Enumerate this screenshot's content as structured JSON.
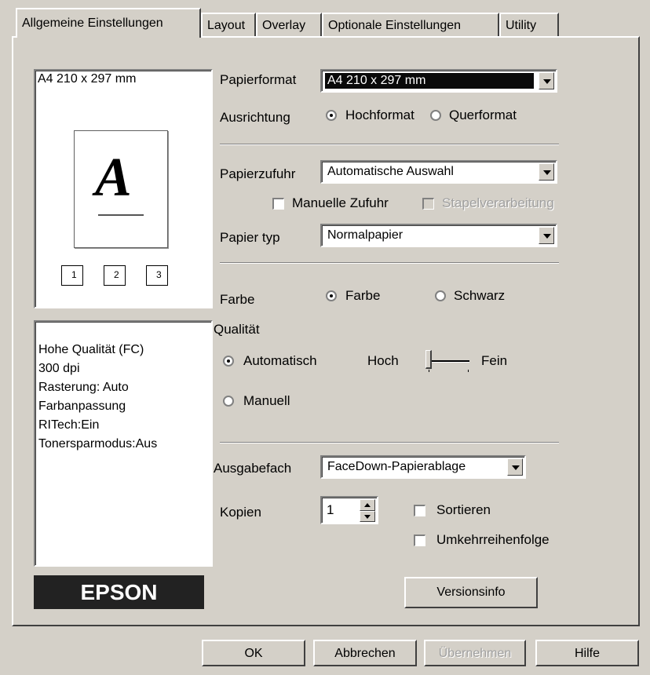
{
  "tabs": [
    {
      "label": "Allgemeine Einstellungen"
    },
    {
      "label": "Layout"
    },
    {
      "label": "Overlay"
    },
    {
      "label": "Optionale Einstellungen"
    },
    {
      "label": "Utility"
    }
  ],
  "preview": {
    "format_text": "A4 210 x 297 mm",
    "page_letter": "A",
    "copy_icons": [
      "1",
      "2",
      "3"
    ]
  },
  "info": {
    "lines": [
      "Hohe Qualität (FC)",
      "300 dpi",
      "Rasterung: Auto",
      "Farbanpassung",
      "RITech:Ein",
      "Tonersparmodus:Aus"
    ]
  },
  "brand": "EPSON",
  "paper_format": {
    "label": "Papierformat",
    "value": "A4 210 x 297 mm"
  },
  "orientation": {
    "label": "Ausrichtung",
    "portrait": "Hochformat",
    "landscape": "Querformat",
    "selected": "portrait"
  },
  "paper_source": {
    "label": "Papierzufuhr",
    "value": "Automatische Auswahl"
  },
  "manual_feed": {
    "label": "Manuelle Zufuhr",
    "checked": false
  },
  "batch": {
    "label": "Stapelverarbeitung",
    "enabled": false
  },
  "paper_type": {
    "label": "Papier typ",
    "value": "Normalpapier"
  },
  "color": {
    "label": "Farbe",
    "color_option": "Farbe",
    "bw_option": "Schwarz",
    "selected": "color"
  },
  "quality": {
    "label": "Qualität",
    "auto": "Automatisch",
    "manual": "Manuell",
    "selected": "auto",
    "high": "Hoch",
    "fine": "Fein"
  },
  "output_tray": {
    "label": "Ausgabefach",
    "value": "FaceDown-Papierablage"
  },
  "copies": {
    "label": "Kopien",
    "value": "1"
  },
  "collate": {
    "label": "Sortieren",
    "checked": false
  },
  "reverse": {
    "label": "Umkehrreihenfolge",
    "checked": false
  },
  "version_button": "Versionsinfo",
  "buttons": {
    "ok": "OK",
    "cancel": "Abbrechen",
    "apply": "Übernehmen",
    "help": "Hilfe"
  }
}
